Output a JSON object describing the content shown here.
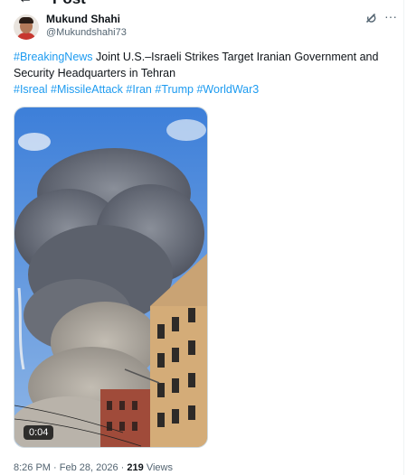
{
  "header": {
    "back_icon": "arrow-left-icon",
    "title": "Post"
  },
  "author": {
    "name": "Mukund Shahi",
    "handle": "@Mukundshahi73",
    "avatar_icon": "avatar"
  },
  "actions": {
    "grok_icon": "grok-icon",
    "more_icon": "more-horizontal-icon",
    "more_glyph": "···"
  },
  "tweet": {
    "lead_hashtag": "#BreakingNews",
    "body": " Joint U.S.–Israeli Strikes Target Iranian Government and Security Headquarters in Tehran",
    "hashtags": [
      "#Isreal",
      "#MissileAttack",
      "#Iran",
      "#Trump",
      "#WorldWar3"
    ]
  },
  "media": {
    "type": "video",
    "duration": "0:04"
  },
  "meta": {
    "time": "8:26 PM",
    "separator": "·",
    "date": "Feb 28, 2026",
    "views_count": "219",
    "views_label": "Views"
  },
  "colors": {
    "link": "#1d9bf0",
    "secondary_text": "#536471",
    "primary_text": "#0f1419"
  }
}
